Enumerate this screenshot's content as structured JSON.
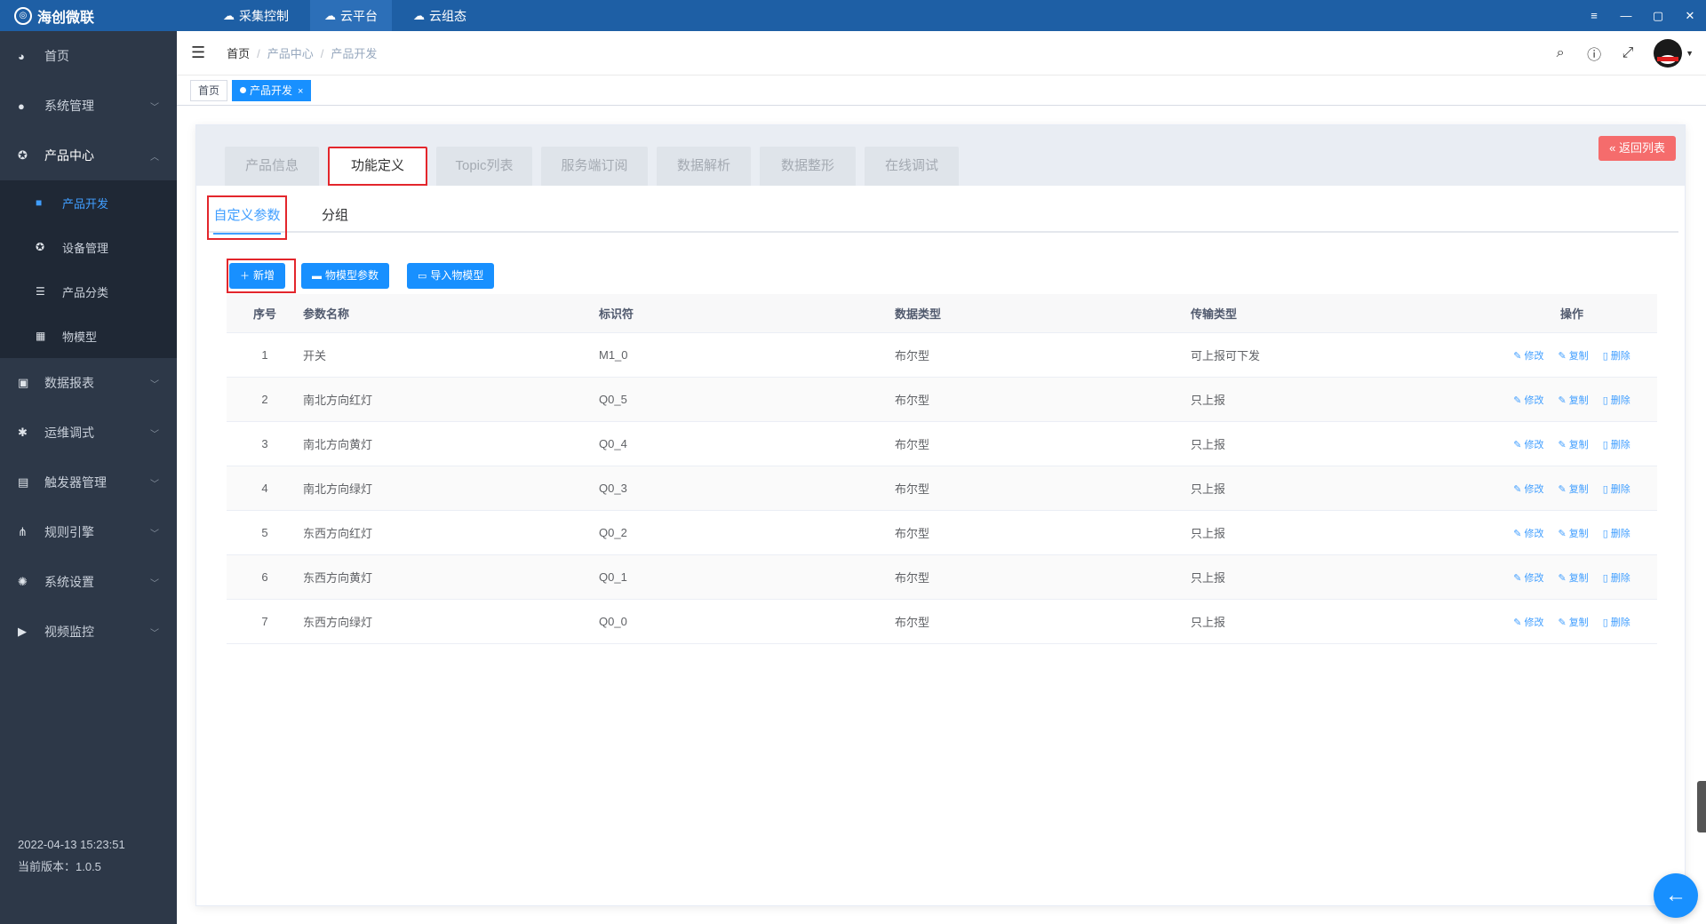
{
  "app": {
    "title": "海创微联",
    "nav": [
      {
        "label": "采集控制",
        "icon": "cloud-sync-icon"
      },
      {
        "label": "云平台",
        "icon": "cloud-icon"
      },
      {
        "label": "云组态",
        "icon": "cloud-config-icon"
      }
    ],
    "window_controls": [
      "≡",
      "—",
      "▢",
      "✕"
    ]
  },
  "sidebar": {
    "items": [
      {
        "label": "首页",
        "icon": "dashboard-icon"
      },
      {
        "label": "系统管理",
        "icon": "user-icon"
      },
      {
        "label": "产品中心",
        "icon": "gear-icon"
      },
      {
        "label": "数据报表",
        "icon": "report-icon"
      },
      {
        "label": "运维调式",
        "icon": "bug-icon"
      },
      {
        "label": "触发器管理",
        "icon": "trigger-icon"
      },
      {
        "label": "规则引擎",
        "icon": "tree-icon"
      },
      {
        "label": "系统设置",
        "icon": "settings-icon"
      },
      {
        "label": "视频监控",
        "icon": "camera-icon"
      }
    ],
    "subitems": [
      {
        "label": "产品开发",
        "icon": "folder-icon"
      },
      {
        "label": "设备管理",
        "icon": "device-icon"
      },
      {
        "label": "产品分类",
        "icon": "list-icon"
      },
      {
        "label": "物模型",
        "icon": "grid-icon"
      }
    ],
    "datetime": "2022-04-13 15:23:51",
    "version": "当前版本：1.0.5"
  },
  "header": {
    "breadcrumb": [
      "首页",
      "产品中心",
      "产品开发"
    ]
  },
  "tagsview": {
    "tags": [
      "首页",
      "产品开发"
    ]
  },
  "product_tabs": [
    "产品信息",
    "功能定义",
    "Topic列表",
    "服务端订阅",
    "数据解析",
    "数据整形",
    "在线调试"
  ],
  "back_button": "返回列表",
  "sub_tabs": [
    "自定义参数",
    "分组"
  ],
  "toolbar": {
    "add": "新增",
    "model_params": "物模型参数",
    "import_model": "导入物模型"
  },
  "table": {
    "headers": [
      "序号",
      "参数名称",
      "标识符",
      "数据类型",
      "传输类型",
      "操作"
    ],
    "rows": [
      {
        "idx": "1",
        "name": "开关",
        "id": "M1_0",
        "type": "布尔型",
        "trans": "可上报可下发"
      },
      {
        "idx": "2",
        "name": "南北方向红灯",
        "id": "Q0_5",
        "type": "布尔型",
        "trans": "只上报"
      },
      {
        "idx": "3",
        "name": "南北方向黄灯",
        "id": "Q0_4",
        "type": "布尔型",
        "trans": "只上报"
      },
      {
        "idx": "4",
        "name": "南北方向绿灯",
        "id": "Q0_3",
        "type": "布尔型",
        "trans": "只上报"
      },
      {
        "idx": "5",
        "name": "东西方向红灯",
        "id": "Q0_2",
        "type": "布尔型",
        "trans": "只上报"
      },
      {
        "idx": "6",
        "name": "东西方向黄灯",
        "id": "Q0_1",
        "type": "布尔型",
        "trans": "只上报"
      },
      {
        "idx": "7",
        "name": "东西方向绿灯",
        "id": "Q0_0",
        "type": "布尔型",
        "trans": "只上报"
      }
    ],
    "ops": {
      "edit": "修改",
      "copy": "复制",
      "delete": "删除"
    }
  },
  "colors": {
    "topbar": "#1e5fa5",
    "sidebar": "#2d3848",
    "primary": "#1890ff",
    "danger": "#f56c6c",
    "highlight": "#e3262c"
  }
}
